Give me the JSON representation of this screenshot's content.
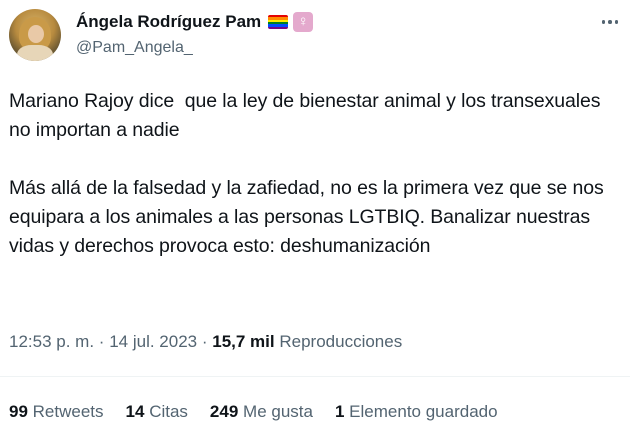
{
  "author": {
    "display_name": "Ángela Rodríguez Pam",
    "handle": "@Pam_Angela_",
    "badges": [
      "rainbow-flag-icon",
      "female-sign-icon"
    ],
    "female_symbol": "♀"
  },
  "tweet": {
    "text": "Mariano Rajoy dice  que la ley de bienestar animal y los transexuales no importan a nadie\n\nMás allá de la falsedad y la zafiedad, no es la primera vez que se nos equipara a los animales a las personas LGTBIQ. Banalizar nuestras vidas y derechos provoca esto: deshumanización",
    "time": "12:53 p. m.",
    "date": "14 jul. 2023",
    "separator": "·",
    "views_count": "15,7 mil",
    "views_label": "Reproducciones"
  },
  "stats": [
    {
      "count": "99",
      "label": "Retweets"
    },
    {
      "count": "14",
      "label": "Citas"
    },
    {
      "count": "249",
      "label": "Me gusta"
    },
    {
      "count": "1",
      "label": "Elemento guardado"
    }
  ],
  "colors": {
    "text_primary": "#0f1419",
    "text_secondary": "#536471",
    "divider": "#eff3f4",
    "badge_female": "#e4a9cd",
    "rainbow": [
      "#e40303",
      "#ff8c00",
      "#ffed00",
      "#008026",
      "#004dff",
      "#750787"
    ]
  },
  "icons": {
    "more": "more-horizontal-icon"
  }
}
